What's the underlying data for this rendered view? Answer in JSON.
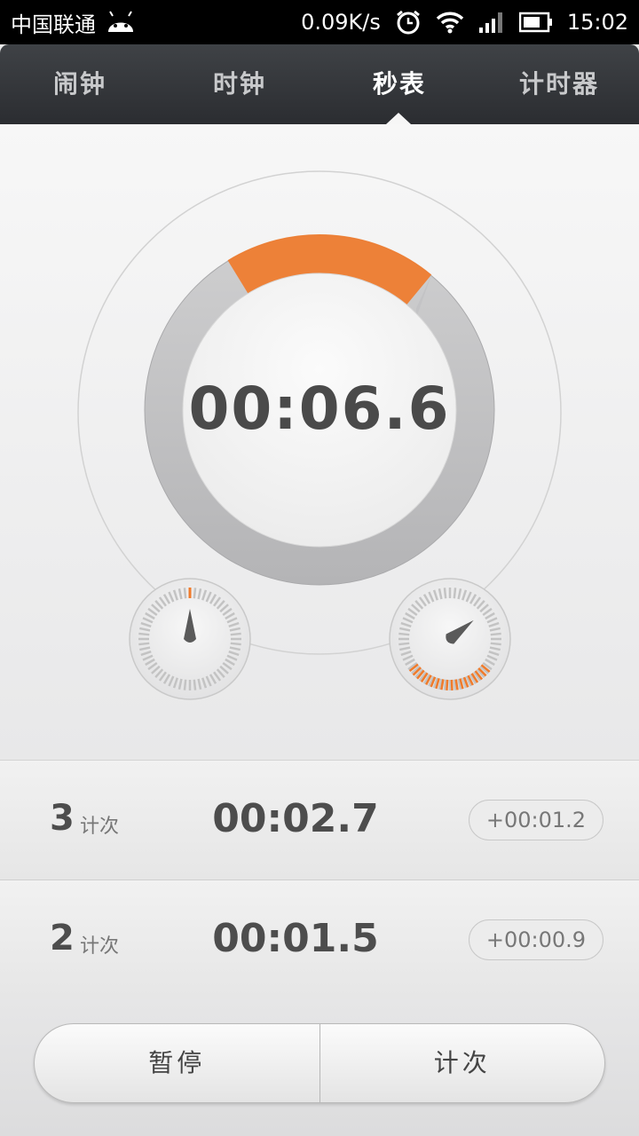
{
  "status_bar": {
    "carrier": "中国联通",
    "speed": "0.09K/s",
    "time": "15:02",
    "icons": [
      "android-icon",
      "alarm-icon",
      "wifi-icon",
      "signal-icon",
      "battery-icon"
    ]
  },
  "tabs": [
    {
      "label": "闹钟",
      "active": false
    },
    {
      "label": "时钟",
      "active": false
    },
    {
      "label": "秒表",
      "active": true
    },
    {
      "label": "计时器",
      "active": false
    }
  ],
  "stopwatch": {
    "time": "00:06.6",
    "progress_fraction": 0.11,
    "accent_color": "#f07b2b",
    "left_gauge_fraction": 0.0,
    "right_gauge_fraction": 0.3
  },
  "laps": [
    {
      "number": "3",
      "unit": "计次",
      "time": "00:02.7",
      "diff": "+00:01.2"
    },
    {
      "number": "2",
      "unit": "计次",
      "time": "00:01.5",
      "diff": "+00:00.9"
    }
  ],
  "controls": {
    "pause_label": "暂停",
    "lap_label": "计次"
  }
}
